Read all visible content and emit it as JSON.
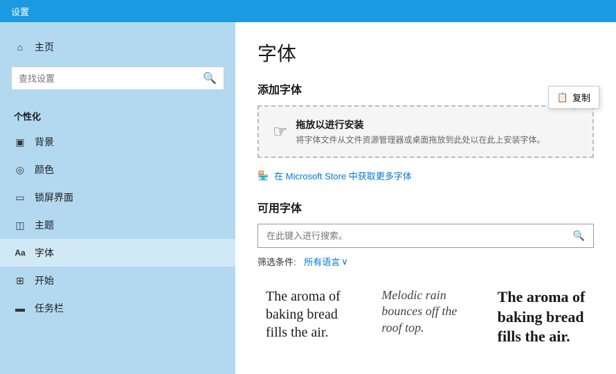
{
  "topbar": {
    "title": "设置"
  },
  "sidebar": {
    "search_placeholder": "查找设置",
    "section_title": "个性化",
    "items": [
      {
        "id": "home",
        "icon": "⌂",
        "label": "主页"
      },
      {
        "id": "background",
        "icon": "▣",
        "label": "背景"
      },
      {
        "id": "colors",
        "icon": "◎",
        "label": "颜色"
      },
      {
        "id": "lockscreen",
        "icon": "▭",
        "label": "锁屏界面"
      },
      {
        "id": "themes",
        "icon": "◫",
        "label": "主题"
      },
      {
        "id": "fonts",
        "icon": "Aa",
        "label": "字体"
      },
      {
        "id": "start",
        "icon": "⊞",
        "label": "开始"
      },
      {
        "id": "taskbar",
        "icon": "▬",
        "label": "任务栏"
      }
    ]
  },
  "content": {
    "page_title": "字体",
    "add_fonts_title": "添加字体",
    "drop_zone": {
      "main_text": "拖放以进行安装",
      "sub_text": "将字体文件从文件资源管理器或桌面拖放到此处以在此上安装字体。",
      "tooltip_text": "复制"
    },
    "store_link_text": "在 Microsoft Store 中获取更多字体",
    "available_fonts_title": "可用字体",
    "search_placeholder": "在此键入进行搜索。",
    "filter_label": "筛选条件:",
    "filter_value": "所有语言",
    "font_previews": [
      {
        "id": "preview1",
        "style": "normal",
        "text": "The aroma of baking bread fills the air."
      },
      {
        "id": "preview2",
        "style": "italic",
        "text": "Melodic rain bounces off the roof top."
      },
      {
        "id": "preview3",
        "style": "bold",
        "text": "The aroma of baking bread fills the air."
      }
    ]
  },
  "icons": {
    "home": "⌂",
    "search": "🔍",
    "store": "🏪",
    "copy": "📋",
    "cursor": "☞",
    "chevron_down": "∨"
  }
}
